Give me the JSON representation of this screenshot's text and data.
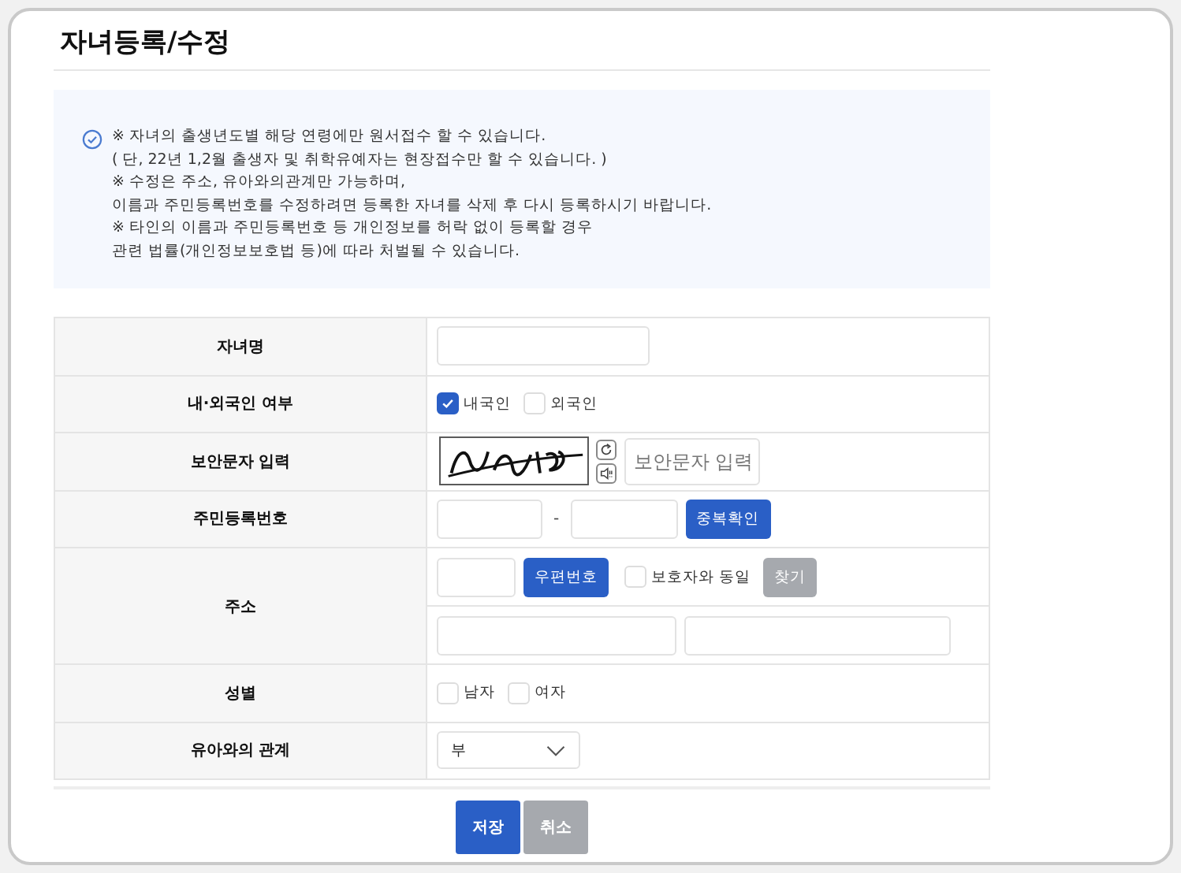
{
  "title": "자녀등록/수정",
  "notice": [
    "※ 자녀의 출생년도별 해당 연령에만 원서접수 할 수 있습니다.",
    "( 단, 22년 1,2월 출생자 및 취학유예자는 현장접수만 할 수 있습니다. )",
    "※ 수정은 주소, 유아와의관계만 가능하며,",
    "이름과 주민등록번호를 수정하려면 등록한 자녀를 삭제 후 다시 등록하시기 바랍니다.",
    "※ 타인의 이름과 주민등록번호 등 개인정보를 허락 없이 등록할 경우",
    "관련 법률(개인정보보호법 등)에 따라 처벌될 수 있습니다."
  ],
  "rows": [
    {
      "kind": "text",
      "label": "자녀명"
    },
    {
      "kind": "checks",
      "label": "내·외국인 여부",
      "options": [
        {
          "label": "내국인",
          "checked": true
        },
        {
          "label": "외국인",
          "checked": false
        }
      ]
    },
    {
      "kind": "captcha",
      "label": "보안문자 입력",
      "placeholder": "보안문자 입력"
    },
    {
      "kind": "rrn",
      "label": "주민등록번호",
      "separator": "-",
      "button": "중복확인"
    },
    {
      "kind": "address",
      "label": "주소",
      "button": "우편번호",
      "same": {
        "label": "보호자와 동일",
        "checked": false
      },
      "find_button": {
        "label": "찾기",
        "disabled": true
      }
    },
    {
      "kind": "checks",
      "label": "성별",
      "options": [
        {
          "label": "남자",
          "checked": false
        },
        {
          "label": "여자",
          "checked": false
        }
      ]
    },
    {
      "kind": "select",
      "label": "유아와의 관계",
      "value": "부"
    }
  ],
  "buttons": [
    {
      "label": "저장",
      "kind": "primary"
    },
    {
      "label": "취소",
      "kind": "secondary"
    }
  ]
}
